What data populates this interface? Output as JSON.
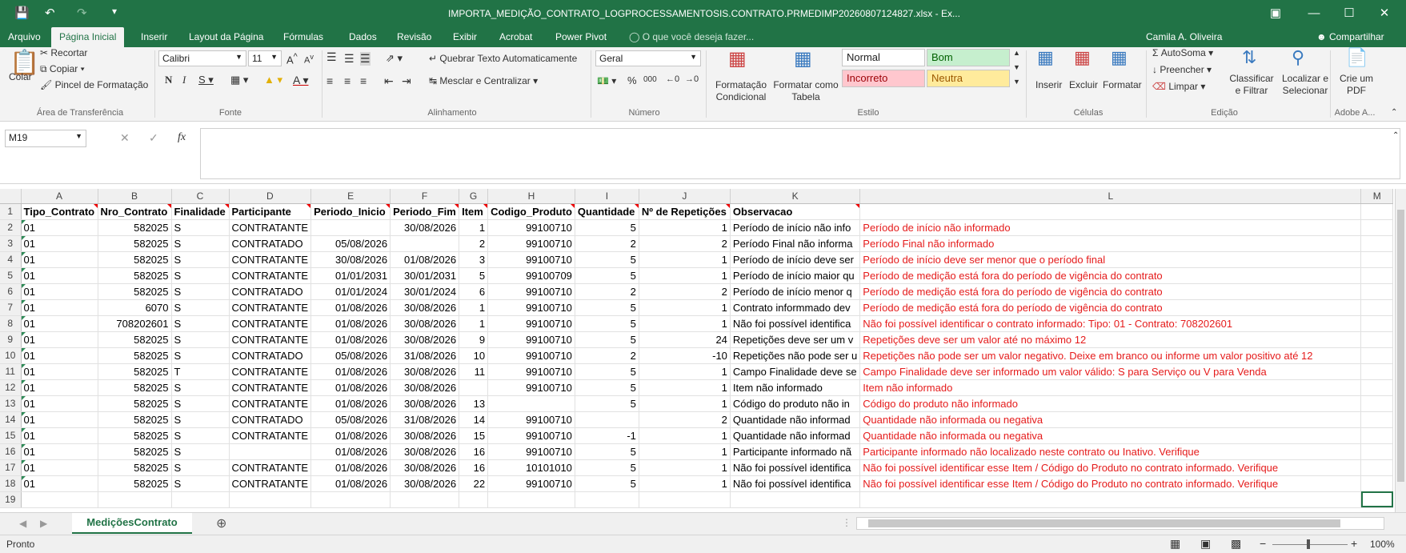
{
  "titlebar": {
    "title": "IMPORTA_MEDIÇÃO_CONTRATO_LOGPROCESSAMENTOSIS.CONTRATO.PRMEDIMP20260807124827.xlsx - Ex...",
    "save_icon": "save-icon",
    "undo_icon": "undo-icon",
    "redo_icon": "redo-icon"
  },
  "tabs": {
    "file": "Arquivo",
    "home": "Página Inicial",
    "insert": "Inserir",
    "layout": "Layout da Página",
    "formulas": "Fórmulas",
    "data": "Dados",
    "review": "Revisão",
    "view": "Exibir",
    "acrobat": "Acrobat",
    "powerpivot": "Power Pivot",
    "tellme": "O que você deseja fazer...",
    "user": "Camila A. Oliveira",
    "share": "Compartilhar"
  },
  "ribbon": {
    "clipboard": {
      "paste": "Colar",
      "cut": "Recortar",
      "copy": "Copiar",
      "format_painter": "Pincel de Formatação",
      "group": "Área de Transferência"
    },
    "font": {
      "name": "Calibri",
      "size": "11",
      "group": "Fonte"
    },
    "alignment": {
      "wrap": "Quebrar Texto Automaticamente",
      "merge": "Mesclar e Centralizar",
      "group": "Alinhamento"
    },
    "number": {
      "format": "Geral",
      "group": "Número"
    },
    "styles": {
      "conditional": "Formatação Condicional",
      "table": "Formatar como Tabela",
      "normal": "Normal",
      "good": "Bom",
      "bad": "Incorreto",
      "neutral": "Neutra",
      "group": "Estilo"
    },
    "cells": {
      "insert": "Inserir",
      "delete": "Excluir",
      "format": "Formatar",
      "group": "Células"
    },
    "editing": {
      "autosum": "AutoSoma",
      "fill": "Preencher",
      "clear": "Limpar",
      "sort": "Classificar e Filtrar",
      "find": "Localizar e Selecionar",
      "group": "Edição"
    },
    "adobe": {
      "create_pdf": "Crie um PDF",
      "group": "Adobe A..."
    }
  },
  "namebox": "M19",
  "formula": "",
  "columns": [
    "A",
    "B",
    "C",
    "D",
    "E",
    "F",
    "G",
    "H",
    "I",
    "J",
    "K",
    "L",
    "M"
  ],
  "header_row": [
    "Tipo_Contrato",
    "Nro_Contrato",
    "Finalidade",
    "Participante",
    "Periodo_Inicio",
    "Periodo_Fim",
    "Item",
    "Codigo_Produto",
    "Quantidade",
    "Nº de Repetições",
    "Observacao",
    ""
  ],
  "rows": [
    [
      "01",
      "582025",
      "S",
      "CONTRATANTE",
      "",
      "30/08/2026",
      "1",
      "99100710",
      "5",
      "1",
      "Período de início não info",
      "Período de início não informado"
    ],
    [
      "01",
      "582025",
      "S",
      "CONTRATADO",
      "05/08/2026",
      "",
      "2",
      "99100710",
      "2",
      "2",
      "Período Final não informa",
      "Período Final não informado"
    ],
    [
      "01",
      "582025",
      "S",
      "CONTRATANTE",
      "30/08/2026",
      "01/08/2026",
      "3",
      "99100710",
      "5",
      "1",
      "Período de início deve ser",
      "Período de início deve ser menor que o período final"
    ],
    [
      "01",
      "582025",
      "S",
      "CONTRATANTE",
      "01/01/2031",
      "30/01/2031",
      "5",
      "99100709",
      "5",
      "1",
      "Período de início maior qu",
      "Período de medição está fora do período de vigência do contrato"
    ],
    [
      "01",
      "582025",
      "S",
      "CONTRATADO",
      "01/01/2024",
      "30/01/2024",
      "6",
      "99100710",
      "2",
      "2",
      "Período de início menor q",
      "Período de medição está fora do período de vigência do contrato"
    ],
    [
      "01",
      "6070",
      "S",
      "CONTRATANTE",
      "01/08/2026",
      "30/08/2026",
      "1",
      "99100710",
      "5",
      "1",
      "Contrato informmado dev",
      "Período de medição está fora do período de vigência do contrato"
    ],
    [
      "01",
      "708202601",
      "S",
      "CONTRATANTE",
      "01/08/2026",
      "30/08/2026",
      "1",
      "99100710",
      "5",
      "1",
      "Não foi possível identifica",
      "Não foi possível identificar o contrato informado: Tipo: 01 - Contrato: 708202601"
    ],
    [
      "01",
      "582025",
      "S",
      "CONTRATANTE",
      "01/08/2026",
      "30/08/2026",
      "9",
      "99100710",
      "5",
      "24",
      "Repetições deve ser um v",
      "Repetições deve ser um valor até no máximo 12"
    ],
    [
      "01",
      "582025",
      "S",
      "CONTRATADO",
      "05/08/2026",
      "31/08/2026",
      "10",
      "99100710",
      "2",
      "-10",
      "Repetições não pode ser u",
      "Repetições não pode ser um valor negativo. Deixe em branco ou informe um valor positivo até 12"
    ],
    [
      "01",
      "582025",
      "T",
      "CONTRATANTE",
      "01/08/2026",
      "30/08/2026",
      "11",
      "99100710",
      "5",
      "1",
      "Campo Finalidade deve se",
      "Campo Finalidade deve ser informado um valor válido: S para Serviço ou V para Venda"
    ],
    [
      "01",
      "582025",
      "S",
      "CONTRATANTE",
      "01/08/2026",
      "30/08/2026",
      "",
      "99100710",
      "5",
      "1",
      "Item não informado",
      "Item não informado"
    ],
    [
      "01",
      "582025",
      "S",
      "CONTRATANTE",
      "01/08/2026",
      "30/08/2026",
      "13",
      "",
      "5",
      "1",
      "Código do produto não in",
      "Código do produto não informado"
    ],
    [
      "01",
      "582025",
      "S",
      "CONTRATADO",
      "05/08/2026",
      "31/08/2026",
      "14",
      "99100710",
      "",
      "2",
      "Quantidade não informad",
      "Quantidade não informada ou negativa"
    ],
    [
      "01",
      "582025",
      "S",
      "CONTRATANTE",
      "01/08/2026",
      "30/08/2026",
      "15",
      "99100710",
      "-1",
      "1",
      "Quantidade não informad",
      "Quantidade não informada ou negativa"
    ],
    [
      "01",
      "582025",
      "S",
      "",
      "01/08/2026",
      "30/08/2026",
      "16",
      "99100710",
      "5",
      "1",
      "Participante informado nã",
      "Participante informado não localizado neste contrato ou Inativo. Verifique"
    ],
    [
      "01",
      "582025",
      "S",
      "CONTRATANTE",
      "01/08/2026",
      "30/08/2026",
      "16",
      "10101010",
      "5",
      "1",
      "Não foi possível identifica",
      "Não foi possível identificar esse Item / Código do Produto no contrato informado. Verifique"
    ],
    [
      "01",
      "582025",
      "S",
      "CONTRATANTE",
      "01/08/2026",
      "30/08/2026",
      "22",
      "99100710",
      "5",
      "1",
      "Não foi possível identifica",
      "Não foi possível identificar esse Item / Código do Produto no contrato informado. Verifique"
    ]
  ],
  "sheet_tab": "MediçõesContrato",
  "status": {
    "ready": "Pronto",
    "zoom": "100%"
  },
  "colors": {
    "accent": "#217346",
    "error_text": "#e51b1b"
  }
}
